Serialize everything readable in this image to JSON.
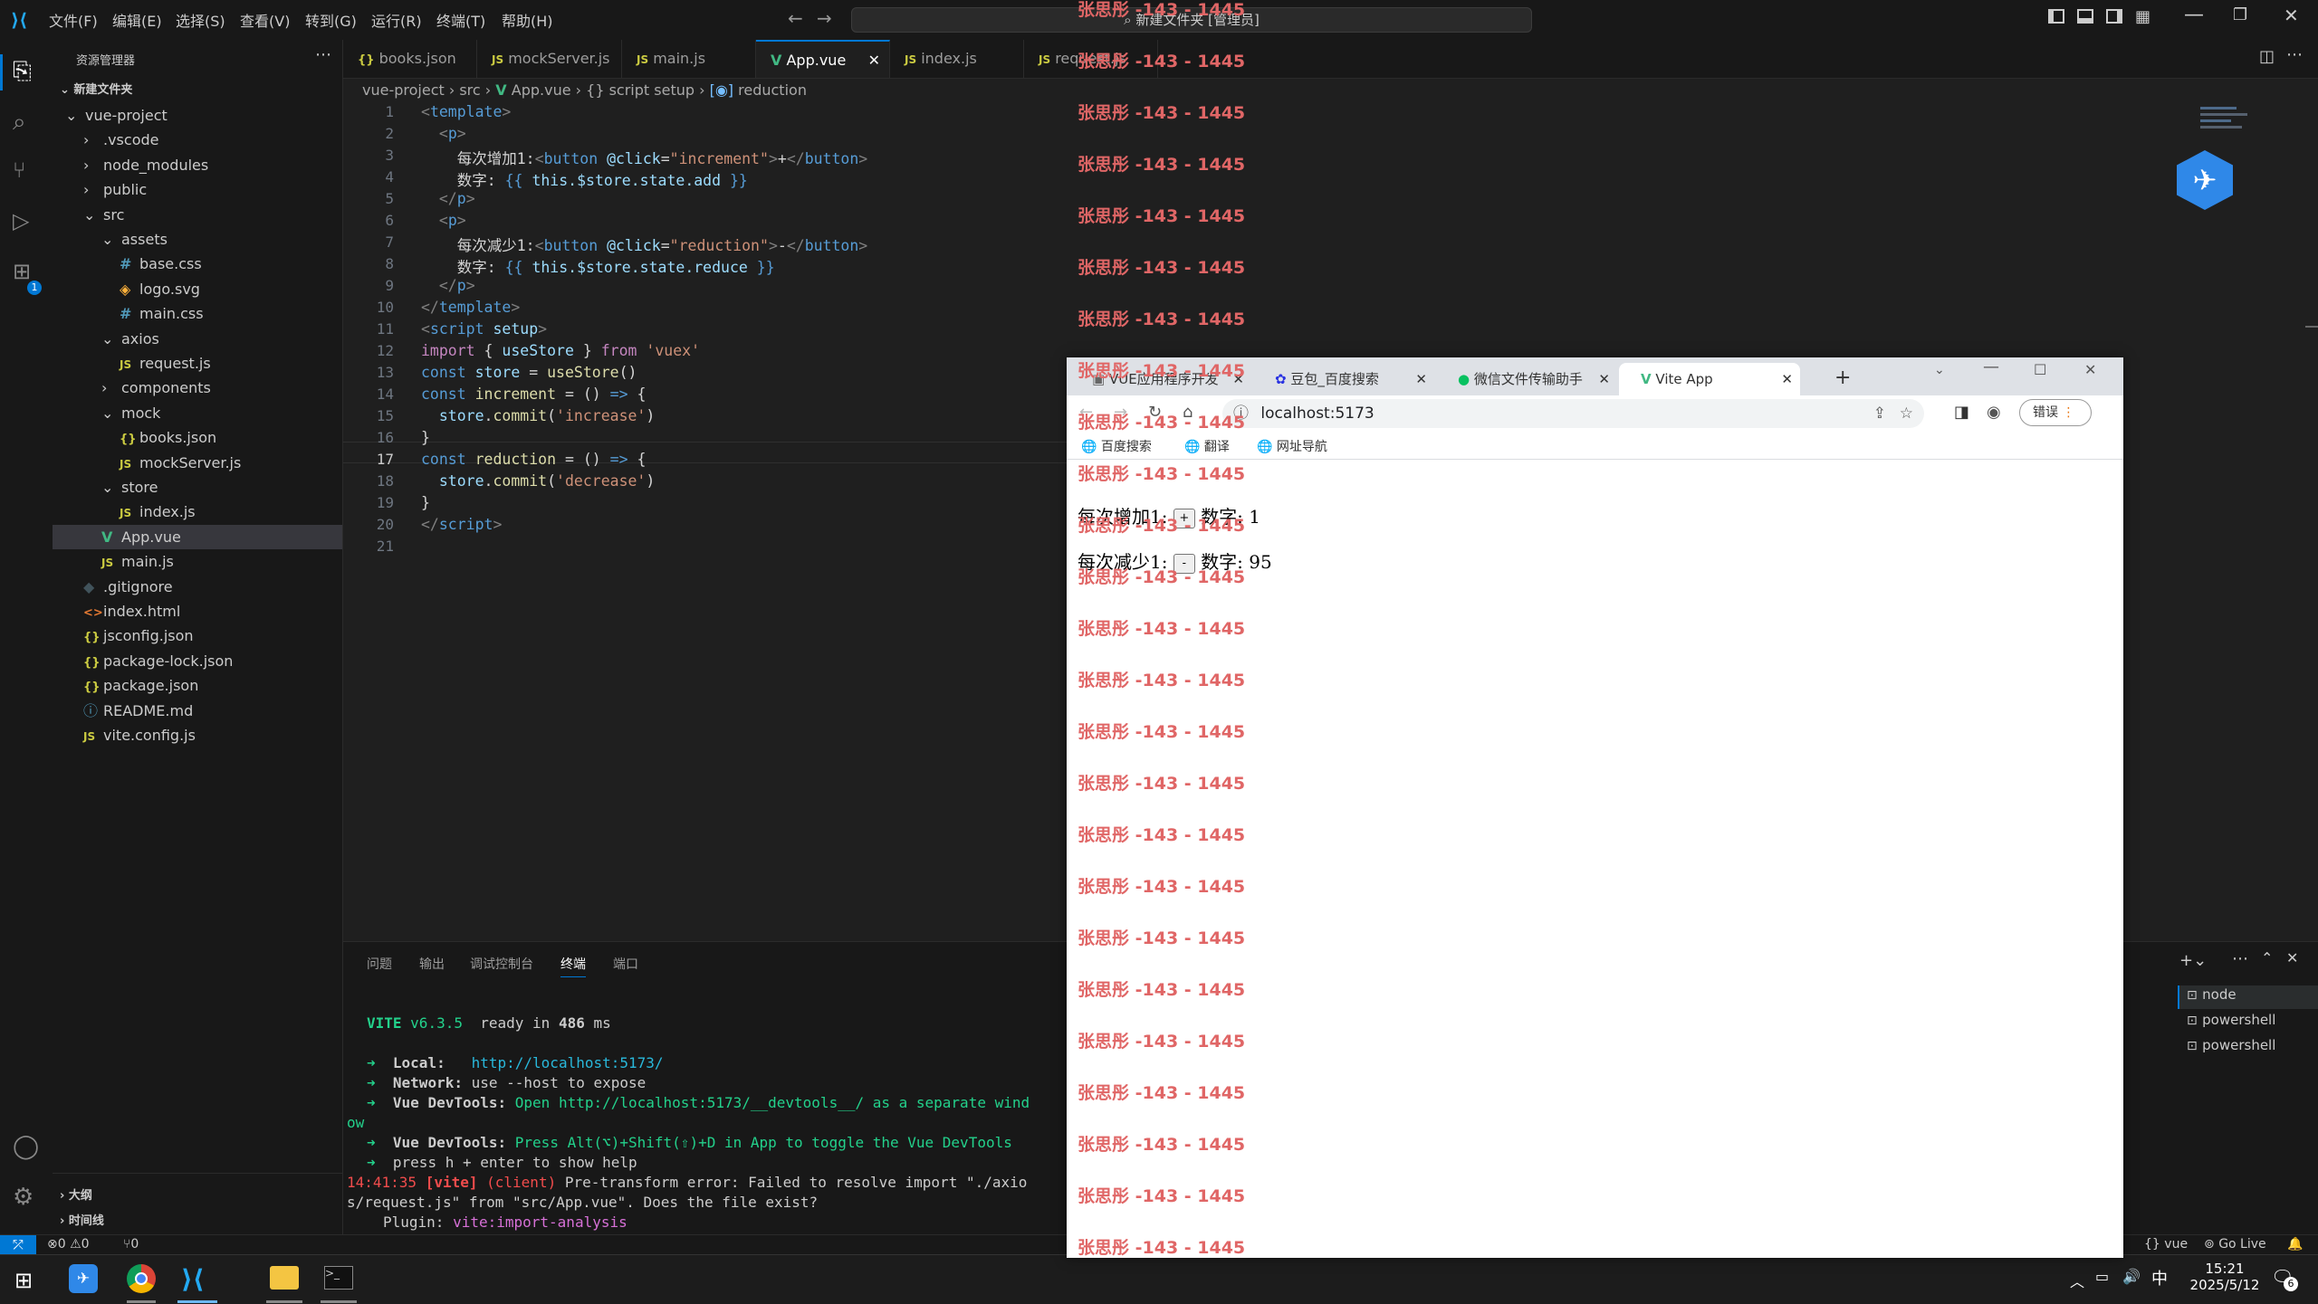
{
  "titlebar": {
    "menus": [
      "文件(F)",
      "编辑(E)",
      "选择(S)",
      "查看(V)",
      "转到(G)",
      "运行(R)",
      "终端(T)",
      "帮助(H)"
    ],
    "search": "新建文件夹 [管理员]"
  },
  "sidebar": {
    "title": "资源管理器",
    "root": "新建文件夹",
    "items": [
      {
        "label": "vue-project",
        "icon": "chevron-down",
        "indent": 0
      },
      {
        "label": ".vscode",
        "icon": "chevron-right",
        "indent": 1
      },
      {
        "label": "node_modules",
        "icon": "chevron-right",
        "indent": 1
      },
      {
        "label": "public",
        "icon": "chevron-right",
        "indent": 1
      },
      {
        "label": "src",
        "icon": "chevron-down",
        "indent": 1
      },
      {
        "label": "assets",
        "icon": "chevron-down",
        "indent": 2
      },
      {
        "label": "base.css",
        "icon": "css",
        "indent": 3
      },
      {
        "label": "logo.svg",
        "icon": "svg",
        "indent": 3
      },
      {
        "label": "main.css",
        "icon": "css",
        "indent": 3
      },
      {
        "label": "axios",
        "icon": "chevron-down",
        "indent": 2
      },
      {
        "label": "request.js",
        "icon": "js",
        "indent": 3
      },
      {
        "label": "components",
        "icon": "chevron-right",
        "indent": 2
      },
      {
        "label": "mock",
        "icon": "chevron-down",
        "indent": 2
      },
      {
        "label": "books.json",
        "icon": "json",
        "indent": 3
      },
      {
        "label": "mockServer.js",
        "icon": "js",
        "indent": 3
      },
      {
        "label": "store",
        "icon": "chevron-down",
        "indent": 2
      },
      {
        "label": "index.js",
        "icon": "js",
        "indent": 3
      },
      {
        "label": "App.vue",
        "icon": "vue",
        "indent": 2
      },
      {
        "label": "main.js",
        "icon": "js",
        "indent": 2
      },
      {
        "label": ".gitignore",
        "icon": "git",
        "indent": 1
      },
      {
        "label": "index.html",
        "icon": "html",
        "indent": 1
      },
      {
        "label": "jsconfig.json",
        "icon": "json",
        "indent": 1
      },
      {
        "label": "package-lock.json",
        "icon": "json",
        "indent": 1
      },
      {
        "label": "package.json",
        "icon": "json",
        "indent": 1
      },
      {
        "label": "README.md",
        "icon": "md",
        "indent": 1
      },
      {
        "label": "vite.config.js",
        "icon": "js",
        "indent": 1
      }
    ],
    "outline": "大纲",
    "timeline": "时间线"
  },
  "tabs": [
    {
      "label": "books.json",
      "icon": "{}"
    },
    {
      "label": "mockServer.js",
      "icon": "JS"
    },
    {
      "label": "main.js",
      "icon": "JS"
    },
    {
      "label": "App.vue",
      "icon": "V",
      "active": true
    },
    {
      "label": "index.js",
      "icon": "JS"
    },
    {
      "label": "request.js",
      "icon": "JS"
    }
  ],
  "breadcrumb": {
    "parts": [
      "vue-project",
      "src",
      "App.vue",
      "script setup",
      "reduction"
    ]
  },
  "editor": {
    "line_numbers": [
      "1",
      "2",
      "3",
      "4",
      "5",
      "6",
      "7",
      "8",
      "9",
      "10",
      "11",
      "12",
      "13",
      "14",
      "15",
      "16",
      "17",
      "18",
      "19",
      "20",
      "21"
    ],
    "lines": {
      "l3_text": "每次增加1:",
      "l3_event": "@click",
      "l3_handler": "\"increment\"",
      "l3_btn": "+",
      "l4_text": "数字:",
      "l4_expr": "this.$store.state.add",
      "l7_text": "每次减少1:",
      "l7_handler": "\"reduction\"",
      "l7_btn": "-",
      "l8_expr": "this.$store.state.reduce",
      "l12_mod": "'vuex'",
      "l15_arg": "'increase'",
      "l18_arg": "'decrease'"
    }
  },
  "panel": {
    "tabs": [
      "问题",
      "输出",
      "调试控制台",
      "终端",
      "端口"
    ],
    "active_tab": "终端",
    "terminals": [
      "node",
      "powershell",
      "powershell"
    ],
    "output": {
      "vite_label": "VITE",
      "vite_version": "v6.3.5",
      "ready": "ready in",
      "ready_ms": "486",
      "ms": "ms",
      "local_label": "Local:",
      "local_url": "http://localhost:5173/",
      "network_label": "Network:",
      "network_text": "use --host to expose",
      "devtools_label": "Vue DevTools:",
      "devtools_open": "Open http://localhost:5173/__devtools__/ as a separate wind",
      "devtools_wrap": "ow",
      "devtools2_label": "Vue DevTools:",
      "devtools2_text": "Press Alt(⌥)+Shift(⇧)+D in App to toggle the Vue DevTools",
      "press_help": "press h + enter to show help",
      "error_time": "14:41:35",
      "error_tag": "[vite]",
      "error_client": "(client)",
      "error_msg1": "Pre-transform error: Failed to resolve import \"./axio",
      "error_msg2": "s/request.js\" from \"src/App.vue\". Does the file exist?",
      "plugin_label": "Plugin:",
      "plugin_name": "vite:import-analysis"
    }
  },
  "statusbar": {
    "errors": "0",
    "warnings": "0",
    "ports": "0",
    "language": "vue",
    "golive": "Go Live"
  },
  "browser": {
    "tabs": [
      {
        "label": "VUE应用程序开发"
      },
      {
        "label": "豆包_百度搜索"
      },
      {
        "label": "微信文件传输助手"
      },
      {
        "label": "Vite App",
        "active": true
      }
    ],
    "url": "localhost:5173",
    "error_btn": "错误",
    "bookmarks": [
      "百度搜索",
      "翻译",
      "网址导航"
    ],
    "page": {
      "inc_label": "每次增加1:",
      "inc_btn": "+",
      "inc_num_label": "数字:",
      "inc_value": "1",
      "dec_label": "每次减少1:",
      "dec_btn": "-",
      "dec_num_label": "数字:",
      "dec_value": "95"
    }
  },
  "watermark": {
    "text": "张思彤 -143 - 1445"
  },
  "taskbar": {
    "time": "15:21",
    "date": "2025/5/12",
    "ime": "中",
    "notifications": "6"
  }
}
